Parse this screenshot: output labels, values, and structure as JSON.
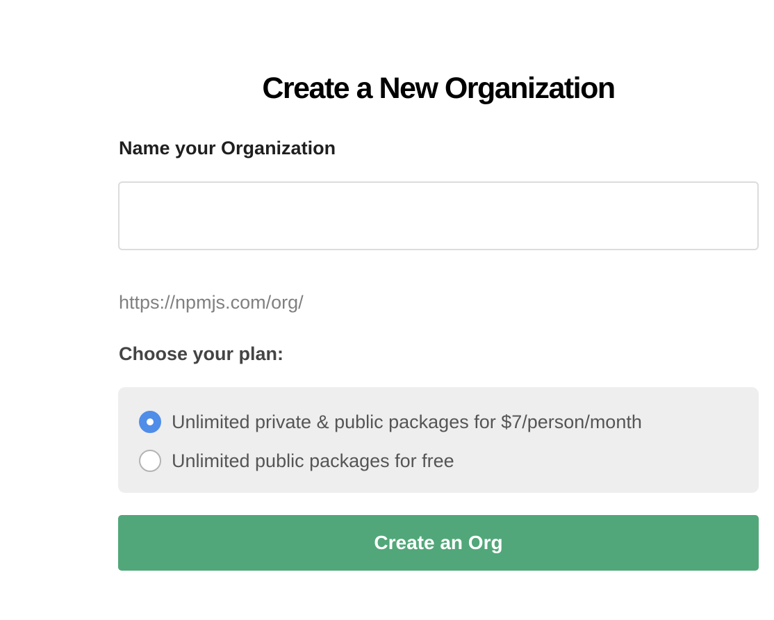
{
  "page": {
    "title": "Create a New Organization"
  },
  "form": {
    "name_label": "Name your Organization",
    "name_value": "",
    "url_prefix": "https://npmjs.com/org/",
    "plan_label": "Choose your plan:",
    "plans": [
      {
        "label": "Unlimited private & public packages for $7/person/month",
        "selected": true
      },
      {
        "label": "Unlimited public packages for free",
        "selected": false
      }
    ],
    "submit_label": "Create an Org"
  },
  "colors": {
    "accent_green": "#51a779",
    "radio_selected": "#4f8de8",
    "plan_box_bg": "#eeeeee"
  }
}
